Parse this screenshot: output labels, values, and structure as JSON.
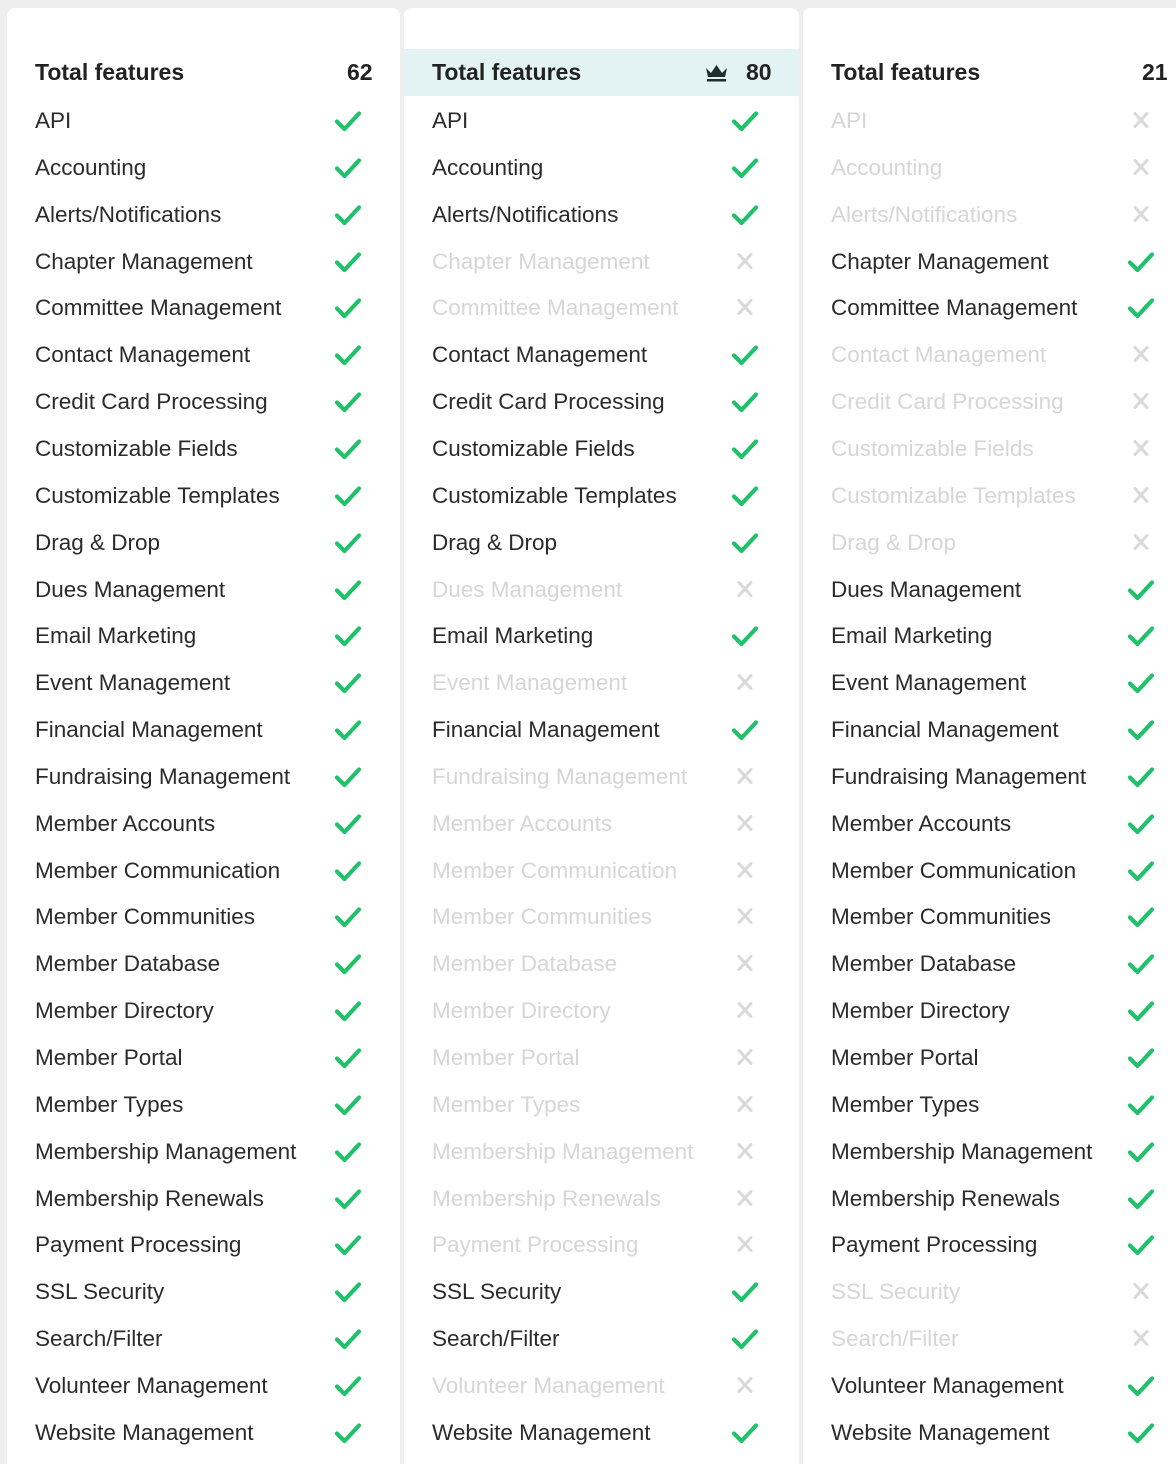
{
  "colors": {
    "check": "#1fc26b",
    "cross": "#d9d9d9",
    "highlight_header": "#e3f3f4"
  },
  "columns": [
    {
      "header": {
        "label": "Total features",
        "count": "62",
        "icon": null
      },
      "features": [
        {
          "name": "API",
          "included": true
        },
        {
          "name": "Accounting",
          "included": true
        },
        {
          "name": "Alerts/Notifications",
          "included": true
        },
        {
          "name": "Chapter Management",
          "included": true
        },
        {
          "name": "Committee Management",
          "included": true
        },
        {
          "name": "Contact Management",
          "included": true
        },
        {
          "name": "Credit Card Processing",
          "included": true
        },
        {
          "name": "Customizable Fields",
          "included": true
        },
        {
          "name": "Customizable Templates",
          "included": true
        },
        {
          "name": "Drag & Drop",
          "included": true
        },
        {
          "name": "Dues Management",
          "included": true
        },
        {
          "name": "Email Marketing",
          "included": true
        },
        {
          "name": "Event Management",
          "included": true
        },
        {
          "name": "Financial Management",
          "included": true
        },
        {
          "name": "Fundraising Management",
          "included": true
        },
        {
          "name": "Member Accounts",
          "included": true
        },
        {
          "name": "Member Communication",
          "included": true
        },
        {
          "name": "Member Communities",
          "included": true
        },
        {
          "name": "Member Database",
          "included": true
        },
        {
          "name": "Member Directory",
          "included": true
        },
        {
          "name": "Member Portal",
          "included": true
        },
        {
          "name": "Member Types",
          "included": true
        },
        {
          "name": "Membership Management",
          "included": true
        },
        {
          "name": "Membership Renewals",
          "included": true
        },
        {
          "name": "Payment Processing",
          "included": true
        },
        {
          "name": "SSL Security",
          "included": true
        },
        {
          "name": "Search/Filter",
          "included": true
        },
        {
          "name": "Volunteer Management",
          "included": true
        },
        {
          "name": "Website Management",
          "included": true
        }
      ]
    },
    {
      "header": {
        "label": "Total features",
        "count": "80",
        "icon": "crown-icon"
      },
      "features": [
        {
          "name": "API",
          "included": true
        },
        {
          "name": "Accounting",
          "included": true
        },
        {
          "name": "Alerts/Notifications",
          "included": true
        },
        {
          "name": "Chapter Management",
          "included": false
        },
        {
          "name": "Committee Management",
          "included": false
        },
        {
          "name": "Contact Management",
          "included": true
        },
        {
          "name": "Credit Card Processing",
          "included": true
        },
        {
          "name": "Customizable Fields",
          "included": true
        },
        {
          "name": "Customizable Templates",
          "included": true
        },
        {
          "name": "Drag & Drop",
          "included": true
        },
        {
          "name": "Dues Management",
          "included": false
        },
        {
          "name": "Email Marketing",
          "included": true
        },
        {
          "name": "Event Management",
          "included": false
        },
        {
          "name": "Financial Management",
          "included": true
        },
        {
          "name": "Fundraising Management",
          "included": false
        },
        {
          "name": "Member Accounts",
          "included": false
        },
        {
          "name": "Member Communication",
          "included": false
        },
        {
          "name": "Member Communities",
          "included": false
        },
        {
          "name": "Member Database",
          "included": false
        },
        {
          "name": "Member Directory",
          "included": false
        },
        {
          "name": "Member Portal",
          "included": false
        },
        {
          "name": "Member Types",
          "included": false
        },
        {
          "name": "Membership Management",
          "included": false
        },
        {
          "name": "Membership Renewals",
          "included": false
        },
        {
          "name": "Payment Processing",
          "included": false
        },
        {
          "name": "SSL Security",
          "included": true
        },
        {
          "name": "Search/Filter",
          "included": true
        },
        {
          "name": "Volunteer Management",
          "included": false
        },
        {
          "name": "Website Management",
          "included": true
        }
      ]
    },
    {
      "header": {
        "label": "Total features",
        "count": "21",
        "icon": null
      },
      "features": [
        {
          "name": "API",
          "included": false
        },
        {
          "name": "Accounting",
          "included": false
        },
        {
          "name": "Alerts/Notifications",
          "included": false
        },
        {
          "name": "Chapter Management",
          "included": true
        },
        {
          "name": "Committee Management",
          "included": true
        },
        {
          "name": "Contact Management",
          "included": false
        },
        {
          "name": "Credit Card Processing",
          "included": false
        },
        {
          "name": "Customizable Fields",
          "included": false
        },
        {
          "name": "Customizable Templates",
          "included": false
        },
        {
          "name": "Drag & Drop",
          "included": false
        },
        {
          "name": "Dues Management",
          "included": true
        },
        {
          "name": "Email Marketing",
          "included": true
        },
        {
          "name": "Event Management",
          "included": true
        },
        {
          "name": "Financial Management",
          "included": true
        },
        {
          "name": "Fundraising Management",
          "included": true
        },
        {
          "name": "Member Accounts",
          "included": true
        },
        {
          "name": "Member Communication",
          "included": true
        },
        {
          "name": "Member Communities",
          "included": true
        },
        {
          "name": "Member Database",
          "included": true
        },
        {
          "name": "Member Directory",
          "included": true
        },
        {
          "name": "Member Portal",
          "included": true
        },
        {
          "name": "Member Types",
          "included": true
        },
        {
          "name": "Membership Management",
          "included": true
        },
        {
          "name": "Membership Renewals",
          "included": true
        },
        {
          "name": "Payment Processing",
          "included": true
        },
        {
          "name": "SSL Security",
          "included": false
        },
        {
          "name": "Search/Filter",
          "included": false
        },
        {
          "name": "Volunteer Management",
          "included": true
        },
        {
          "name": "Website Management",
          "included": true
        }
      ]
    }
  ]
}
